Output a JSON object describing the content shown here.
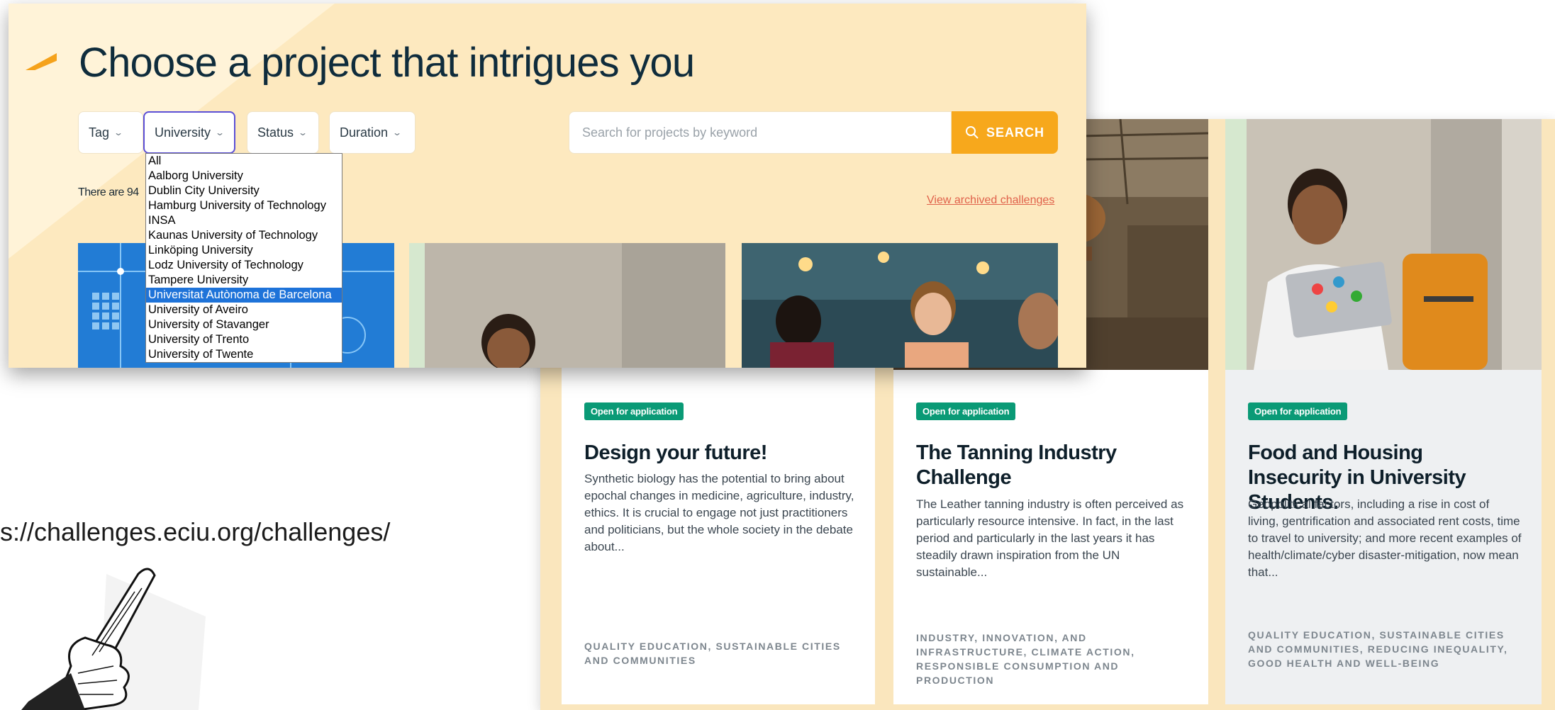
{
  "page": {
    "title": "Choose a project that intrigues you",
    "result_count": "There are 94",
    "archived_link": "View archived challenges"
  },
  "filters": {
    "tag": "Tag",
    "university": "University",
    "status": "Status",
    "duration": "Duration"
  },
  "search": {
    "placeholder": "Search for projects by keyword",
    "button_label": "SEARCH"
  },
  "university_dropdown": {
    "options": [
      "All",
      "Aalborg University",
      "Dublin City University",
      "Hamburg University of Technology",
      "INSA",
      "Kaunas University of Technology",
      "Linköping University",
      "Lodz University of Technology",
      "Tampere University",
      "Universitat Autònoma de Barcelona",
      "University of Aveiro",
      "University of Stavanger",
      "University of Trento",
      "University of Twente"
    ],
    "selected": "Universitat Autònoma de Barcelona"
  },
  "cards": [
    {
      "badge": "Open for application",
      "title": "Design your future!",
      "description": "Synthetic biology has the potential to bring about epochal changes in medicine, agriculture, industry, ethics. It is crucial to engage not just practitioners and politicians, but the whole society in the debate about...",
      "tags": "QUALITY EDUCATION, SUSTAINABLE CITIES AND COMMUNITIES"
    },
    {
      "badge": "Open for application",
      "title": "The Tanning Industry Challenge",
      "description": "The Leather tanning industry is often perceived as particularly resource intensive. In fact, in the last period and particularly in the last years it has steadily drawn inspiration from the UN sustainable...",
      "tags": "INDUSTRY, INNOVATION, AND INFRASTRUCTURE, CLIMATE ACTION, RESPONSIBLE CONSUMPTION AND PRODUCTION"
    },
    {
      "badge": "Open for application",
      "title": "Food and Housing Insecurity in University Students.",
      "description": "Geopolitical factors, including a rise in cost of living, gentrification and associated rent costs, time to travel to university; and more recent examples of health/climate/cyber disaster-mitigation, now mean that...",
      "tags": "QUALITY EDUCATION, SUSTAINABLE CITIES AND COMMUNITIES, REDUCING INEQUALITY, GOOD HEALTH AND WELL-BEING"
    }
  ],
  "annotation": {
    "url": "s://challenges.eciu.org/challenges/"
  },
  "colors": {
    "accent": "#f7a81c",
    "badge": "#0a9a76",
    "link": "#e0614a",
    "panel_bg": "#fde9bf",
    "selection": "#1e73d9"
  }
}
